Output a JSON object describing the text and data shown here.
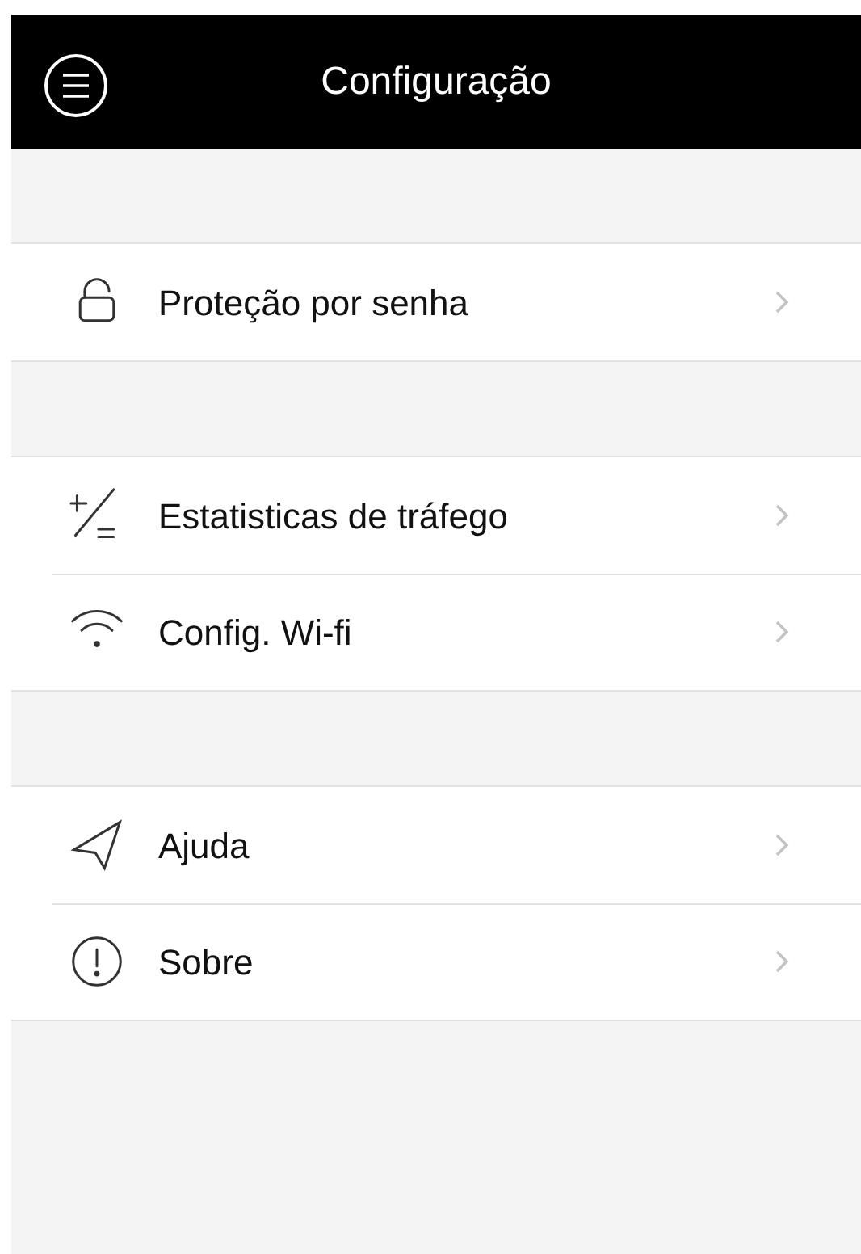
{
  "header": {
    "title": "Configuração"
  },
  "sections": [
    {
      "items": [
        {
          "kind": "lock",
          "label": "Proteção por senha"
        }
      ]
    },
    {
      "items": [
        {
          "kind": "plusminus",
          "label": "Estatisticas de tráfego"
        },
        {
          "kind": "wifi",
          "label": "Config. Wi-fi"
        }
      ]
    },
    {
      "items": [
        {
          "kind": "send",
          "label": "Ajuda"
        },
        {
          "kind": "info",
          "label": "Sobre"
        }
      ]
    }
  ]
}
